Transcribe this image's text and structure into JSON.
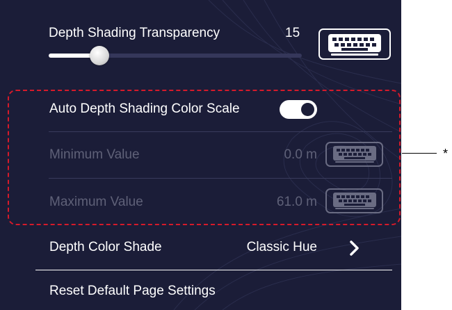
{
  "transparency": {
    "label": "Depth Shading Transparency",
    "value": "15",
    "slider_level_fraction": 0.2,
    "keyboard_icon": "keyboard-icon"
  },
  "auto_scale": {
    "label": "Auto Depth Shading Color Scale",
    "toggle_state": "on"
  },
  "min_value": {
    "label": "Minimum Value",
    "value": "0.0 m",
    "keyboard_icon": "keyboard-icon"
  },
  "max_value": {
    "label": "Maximum Value",
    "value": "61.0 m",
    "keyboard_icon": "keyboard-icon"
  },
  "color_shade": {
    "label": "Depth Color Shade",
    "value": "Classic Hue",
    "chevron_icon": "chevron-right-icon"
  },
  "reset": {
    "label": "Reset Default Page Settings"
  },
  "callout": {
    "marker": "*"
  },
  "colors": {
    "panel_background": "#1b1d38",
    "disabled_text": "#5f6178",
    "highlight_border": "#d61a2a"
  }
}
